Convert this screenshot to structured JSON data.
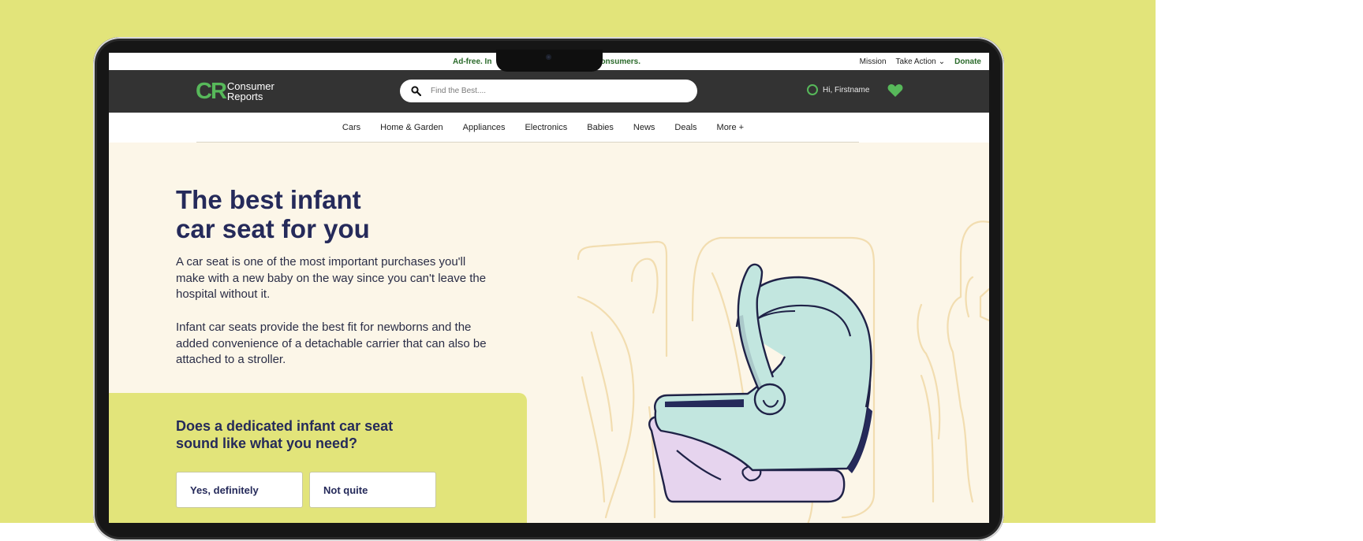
{
  "promo": {
    "left": "Ad-free. In",
    "right": "onsumers."
  },
  "utility_links": {
    "mission": "Mission",
    "take_action": "Take Action",
    "donate": "Donate"
  },
  "logo": {
    "mark": "CR",
    "line1": "Consumer",
    "line2": "Reports"
  },
  "search": {
    "placeholder": "Find the Best...."
  },
  "user": {
    "greeting": "Hi, Firstname"
  },
  "nav": [
    "Cars",
    "Home & Garden",
    "Appliances",
    "Electronics",
    "Babies",
    "News",
    "Deals",
    "More +"
  ],
  "hero": {
    "title_line1": "The best infant",
    "title_line2": "car seat for you",
    "para1": "A car seat is one of the most important purchases you'll make with a new baby on the way since you can't leave the hospital without it.",
    "para2": "Infant car seats provide the best fit for newborns and the added convenience of a detachable carrier that can also be attached to a stroller."
  },
  "quiz": {
    "question": "Does a dedicated infant car seat sound like what you need?",
    "yes": "Yes, definitely",
    "no": "Not quite"
  },
  "colors": {
    "backdrop": "#e2e47a",
    "brand_green": "#57b85a",
    "navy": "#252a5a",
    "cream": "#fcf6e8",
    "header": "#333333"
  }
}
